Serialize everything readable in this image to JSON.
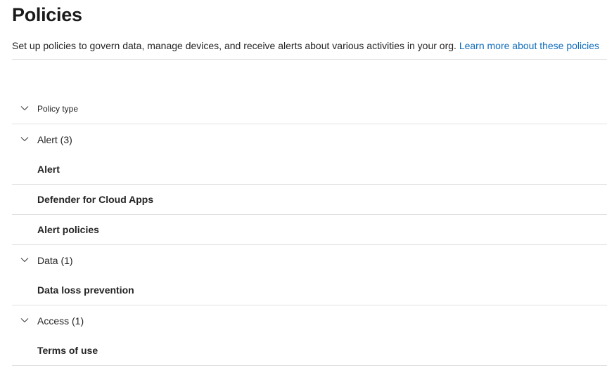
{
  "page": {
    "title": "Policies",
    "description": "Set up policies to govern data, manage devices, and receive alerts about various activities in your org.",
    "learn_more": "Learn more about these policies"
  },
  "table": {
    "column_header": "Policy type",
    "groups": [
      {
        "label": "Alert (3)",
        "items": [
          "Alert",
          "Defender for Cloud Apps",
          "Alert policies"
        ]
      },
      {
        "label": "Data (1)",
        "items": [
          "Data loss prevention"
        ]
      },
      {
        "label": "Access (1)",
        "items": [
          "Terms of use"
        ]
      }
    ]
  },
  "icons": {
    "group_toggle": "chevron-down-icon"
  },
  "colors": {
    "link": "#0f6cbd",
    "divider": "#e1e1e1",
    "text": "#242424"
  }
}
